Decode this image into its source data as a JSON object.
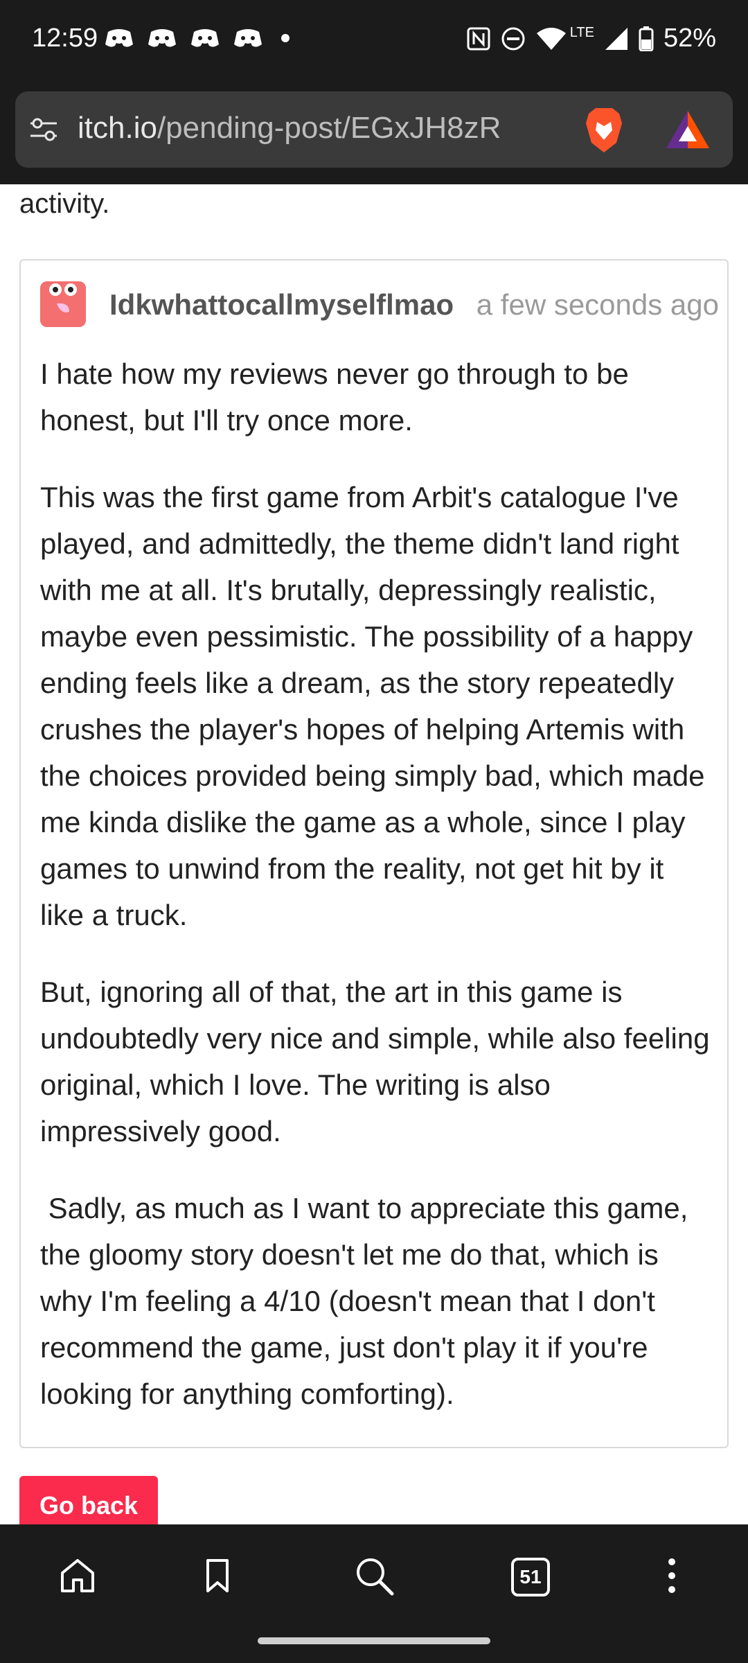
{
  "status_bar": {
    "time": "12:59",
    "battery": "52%",
    "network": "LTE",
    "notification_icons": [
      "discord-icon",
      "discord-icon",
      "discord-icon",
      "discord-icon"
    ]
  },
  "browser": {
    "url_domain": "itch.io",
    "url_path": "/pending-post/EGxJH8zR",
    "tab_count": "51"
  },
  "page": {
    "cut_text": "activity.",
    "post": {
      "username": "Idkwhattocallmyselflmao",
      "timestamp": "a few seconds ago",
      "paragraphs": [
        "I hate how my reviews never go through to be honest, but I'll try once more.",
        "This was the first game from Arbit's catalogue I've played, and admittedly, the theme didn't land right with me at all. It's brutally, depressingly realistic, maybe even pessimistic. The possibility of a happy ending feels like a dream, as the story repeatedly crushes the player's hopes of helping Artemis with the choices provided being simply bad, which made me kinda dislike the game as a whole, since I play games to unwind from the reality, not get hit by it like a truck.",
        "But, ignoring all of that, the art in this game is undoubtedly very nice and simple, while also feeling original, which I love. The writing is also impressively good.",
        " Sadly, as much as I want to appreciate this game, the gloomy story doesn't let me do that, which is why I'm feeling a 4/10 (doesn't mean that I don't recommend the game, just don't play it if you're looking for anything comforting)."
      ]
    },
    "go_back_label": "Go back"
  },
  "colors": {
    "accent": "#fa2b4c",
    "chrome_bg": "#1b1b1b",
    "url_box_bg": "#3a3a3a"
  }
}
